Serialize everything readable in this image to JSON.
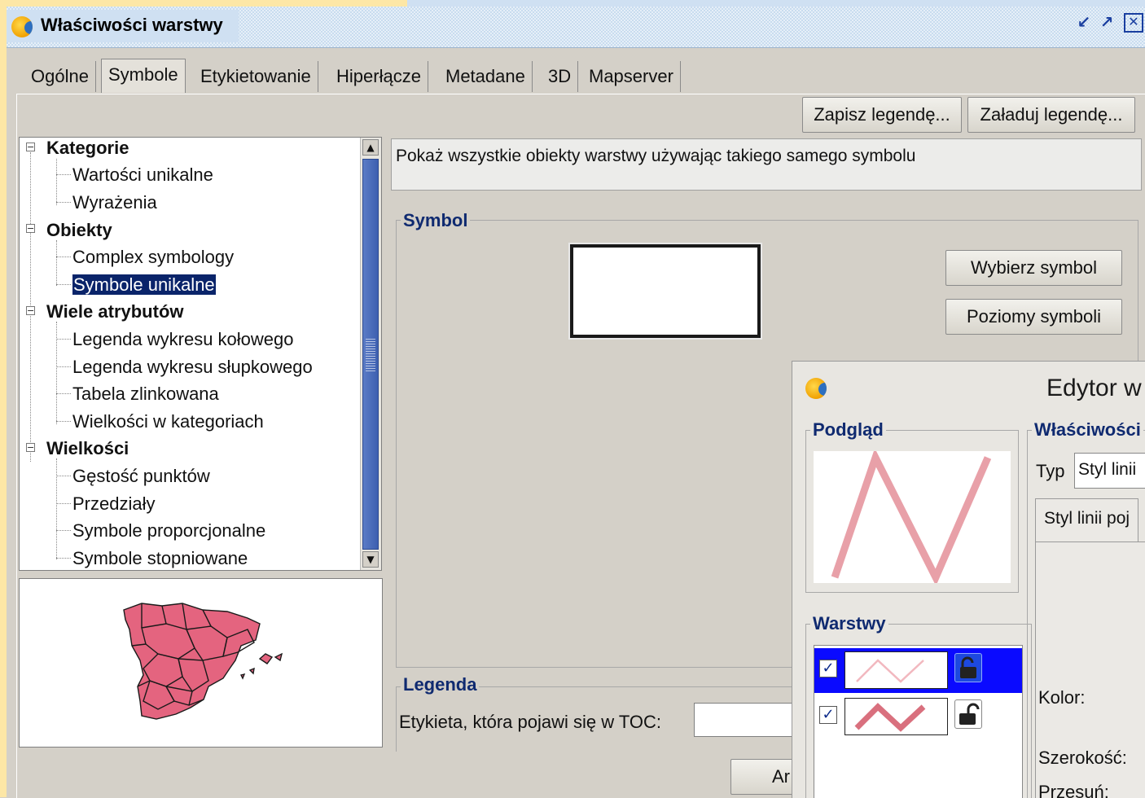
{
  "window": {
    "title": "Właściwości warstwy",
    "buttons": [
      "minimize-icon",
      "maximize-icon",
      "close-icon"
    ]
  },
  "tabs": [
    {
      "label": "Ogólne",
      "active": false
    },
    {
      "label": "Symbole",
      "active": true
    },
    {
      "label": "Etykietowanie",
      "active": false
    },
    {
      "label": "Hiperłącze",
      "active": false
    },
    {
      "label": "Metadane",
      "active": false
    },
    {
      "label": "3D",
      "active": false
    },
    {
      "label": "Mapserver",
      "active": false
    }
  ],
  "toolbar": {
    "save_legend": "Zapisz legendę...",
    "load_legend": "Załaduj legendę..."
  },
  "tree": {
    "categories": [
      {
        "label": "Kategorie",
        "children": [
          "Wartości unikalne",
          "Wyrażenia"
        ]
      },
      {
        "label": "Obiekty",
        "children": [
          "Complex symbology",
          "Symbole unikalne"
        ]
      },
      {
        "label": "Wiele atrybutów",
        "children": [
          "Legenda wykresu kołowego",
          "Legenda wykresu słupkowego",
          "Tabela zlinkowana",
          "Wielkości w kategoriach"
        ]
      },
      {
        "label": "Wielkości",
        "children": [
          "Gęstość punktów",
          "Przedziały",
          "Symbole proporcjonalne",
          "Symbole stopniowane"
        ]
      }
    ],
    "selected": "Symbole unikalne"
  },
  "description": "Pokaż wszystkie obiekty warstwy używając takiego samego symbolu",
  "symbol_group": {
    "title": "Symbol",
    "choose_button": "Wybierz symbol",
    "levels_button": "Poziomy symboli"
  },
  "legend_group": {
    "title": "Legenda",
    "toc_label": "Etykieta, która pojawi się w TOC:",
    "toc_value": ""
  },
  "bottom": {
    "apply_partial": "Ar"
  },
  "editor": {
    "title": "Edytor w",
    "preview_title": "Podgląd",
    "layers_title": "Warstwy",
    "properties_title": "Właściwości",
    "type_label": "Typ",
    "type_value": "Styl linii",
    "tab_label": "Styl linii poj",
    "color_label": "Kolor:",
    "width_label": "Szerokość:",
    "offset_label": "Przesuń:",
    "layers": [
      {
        "checked": true,
        "selected": true
      },
      {
        "checked": true,
        "selected": false
      }
    ]
  },
  "colors": {
    "line_symbol": "#e8a0a8",
    "map_fill": "#e4647f",
    "selection": "#0a246a",
    "group_title": "#0f2a70"
  }
}
